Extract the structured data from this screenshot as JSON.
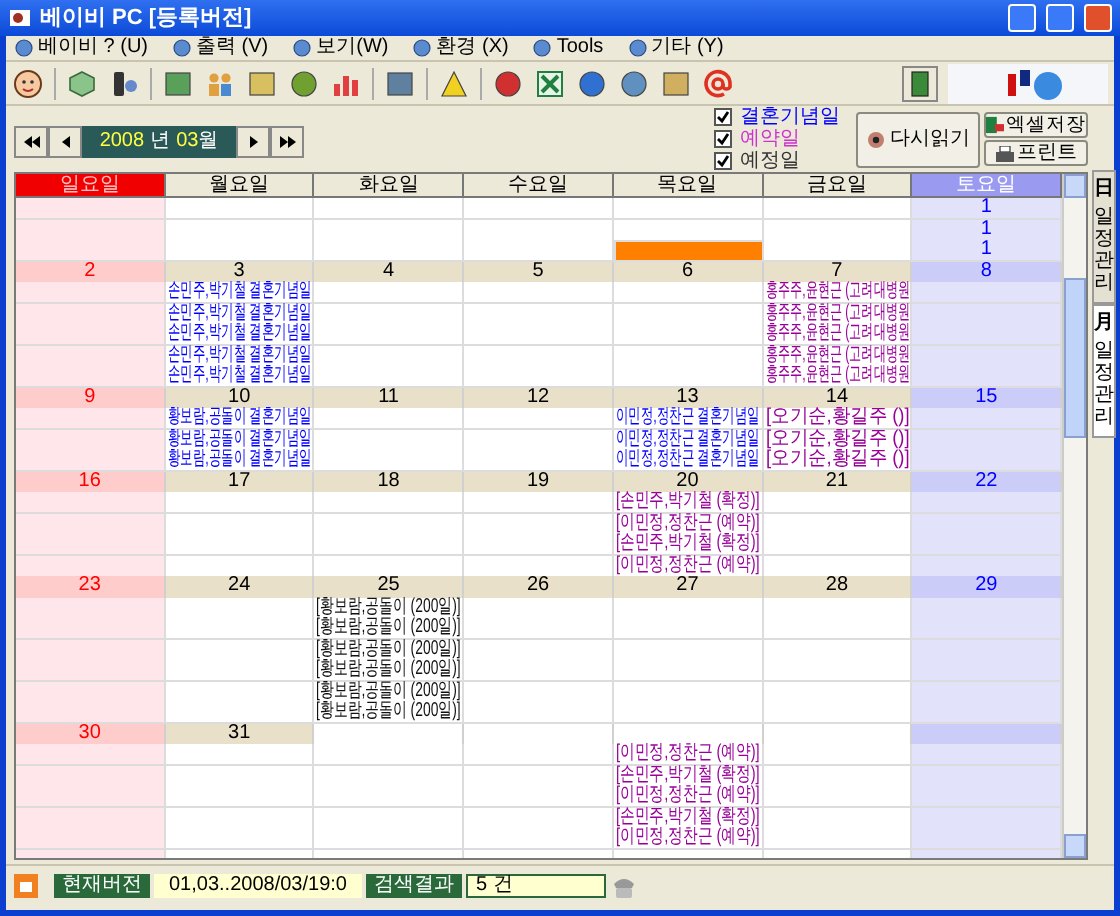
{
  "window": {
    "title": "베이비 PC [등록버전]"
  },
  "menu": [
    {
      "label": "베이비 ? (U)"
    },
    {
      "label": "출력 (V)"
    },
    {
      "label": "보기(W)"
    },
    {
      "label": "환경 (X)"
    },
    {
      "label": "Tools"
    },
    {
      "label": "기타 (Y)"
    }
  ],
  "navigator": {
    "year": "2008",
    "year_suffix": "년",
    "month": "03",
    "month_suffix": "월"
  },
  "legend": [
    {
      "label": "결혼기념일",
      "checked": true,
      "color": "#0000ff"
    },
    {
      "label": "예약일",
      "checked": true,
      "color": "#cc33cc"
    },
    {
      "label": "예정일",
      "checked": true,
      "color": "#333333"
    }
  ],
  "buttons": {
    "reload": "다시읽기",
    "excel": "엑셀저장",
    "print": "프린트"
  },
  "side_tabs": [
    {
      "glyph": "日",
      "label": "일정관리",
      "selected": false
    },
    {
      "glyph": "月",
      "label": "일정관리",
      "selected": true
    }
  ],
  "calendar": {
    "weekdays": [
      "일요일",
      "월요일",
      "화요일",
      "수요일",
      "목요일",
      "금요일",
      "토요일"
    ],
    "weeks": [
      {
        "rows": [
          {
            "sat": {
              "text": "1",
              "kind": "day_number"
            }
          },
          {
            "sat": {
              "text": "1",
              "kind": "day_number"
            }
          },
          {
            "sat": {
              "text": "1",
              "kind": "day_number"
            },
            "thu": {
              "kind": "highlight"
            }
          }
        ]
      },
      {
        "dates": {
          "sun": "2",
          "mon": "3",
          "tue": "4",
          "wed": "5",
          "thu": "6",
          "fri": "7",
          "sat": "8"
        },
        "rows": [
          {
            "mon": {
              "text": "손민주,박기철 결혼기념일",
              "kind": "anniversary"
            },
            "fri": {
              "text": "홍주주,윤현근 (고려대병원",
              "kind": "reservation"
            }
          },
          {
            "mon": {
              "text": "손민주,박기철 결혼기념일",
              "kind": "anniversary"
            },
            "fri": {
              "text": "홍주주,윤현근 (고려대병원",
              "kind": "reservation"
            }
          },
          {
            "mon": {
              "text": "손민주,박기철 결혼기념일",
              "kind": "anniversary"
            },
            "fri": {
              "text": "홍주주,윤현근 (고려대병원",
              "kind": "reservation"
            }
          },
          {
            "mon": {
              "text": "손민주,박기철 결혼기념일",
              "kind": "anniversary"
            },
            "fri": {
              "text": "홍주주,윤현근 (고려대병원",
              "kind": "reservation"
            }
          },
          {
            "mon": {
              "text": "손민주,박기철 결혼기념일",
              "kind": "anniversary"
            },
            "fri": {
              "text": "홍주주,윤현근 (고려대병원",
              "kind": "reservation"
            }
          }
        ]
      },
      {
        "dates": {
          "sun": "9",
          "mon": "10",
          "tue": "11",
          "wed": "12",
          "thu": "13",
          "fri": "14",
          "sat": "15"
        },
        "rows": [
          {
            "mon": {
              "text": "황보람,공돌이 결혼기념일",
              "kind": "anniversary"
            },
            "thu": {
              "text": "이민정,정찬근 결혼기념일",
              "kind": "anniversary"
            },
            "fri": {
              "text": "[오기순,황길주 ()]",
              "kind": "reservation"
            }
          },
          {
            "mon": {
              "text": "황보람,공돌이 결혼기념일",
              "kind": "anniversary"
            },
            "thu": {
              "text": "이민정,정찬근 결혼기념일",
              "kind": "anniversary"
            },
            "fri": {
              "text": "[오기순,황길주 ()]",
              "kind": "reservation"
            }
          },
          {
            "mon": {
              "text": "황보람,공돌이 결혼기념일",
              "kind": "anniversary"
            },
            "thu": {
              "text": "이민정,정찬근 결혼기념일",
              "kind": "anniversary"
            },
            "fri": {
              "text": "[오기순,황길주 ()]",
              "kind": "reservation"
            }
          }
        ]
      },
      {
        "dates": {
          "sun": "16",
          "mon": "17",
          "tue": "18",
          "wed": "19",
          "thu": "20",
          "fri": "21",
          "sat": "22"
        },
        "rows": [
          {
            "thu": {
              "text": "[손민주,박기철 (확정)]",
              "kind": "reservation"
            }
          },
          {
            "thu": {
              "text": "[이민정,정찬근 (예약)]",
              "kind": "reservation"
            }
          },
          {
            "thu": {
              "text": "[손민주,박기철 (확정)]",
              "kind": "reservation"
            }
          },
          {
            "thu": {
              "text": "[이민정,정찬근 (예약)]",
              "kind": "reservation"
            }
          }
        ]
      },
      {
        "dates": {
          "sun": "23",
          "mon": "24",
          "tue": "25",
          "wed": "26",
          "thu": "27",
          "fri": "28",
          "sat": "29"
        },
        "rows": [
          {
            "tue": {
              "text": "[황보람,공돌이 (200일)]",
              "kind": "planned"
            }
          },
          {
            "tue": {
              "text": "[황보람,공돌이 (200일)]",
              "kind": "planned"
            }
          },
          {
            "tue": {
              "text": "[황보람,공돌이 (200일)]",
              "kind": "planned"
            }
          },
          {
            "tue": {
              "text": "[황보람,공돌이 (200일)]",
              "kind": "planned"
            }
          },
          {
            "tue": {
              "text": "[황보람,공돌이 (200일)]",
              "kind": "planned"
            }
          },
          {
            "tue": {
              "text": "[황보람,공돌이 (200일)]",
              "kind": "planned"
            }
          }
        ]
      },
      {
        "dates": {
          "sun": "30",
          "mon": "31"
        },
        "rows": [
          {
            "thu": {
              "text": "[이민정,정찬근 (예약)]",
              "kind": "reservation"
            }
          },
          {
            "thu": {
              "text": "[손민주,박기철 (확정)]",
              "kind": "reservation"
            }
          },
          {
            "thu": {
              "text": "[이민정,정찬근 (예약)]",
              "kind": "reservation"
            }
          },
          {
            "thu": {
              "text": "[손민주,박기철 (확정)]",
              "kind": "reservation"
            }
          },
          {
            "thu": {
              "text": "[이민정,정찬근 (예약)]",
              "kind": "reservation"
            }
          }
        ]
      }
    ]
  },
  "status_bar": {
    "version_label": "현재버전",
    "version_value": "01,03..2008/03/19:0",
    "result_label": "검색결과",
    "result_value": "5 건"
  }
}
